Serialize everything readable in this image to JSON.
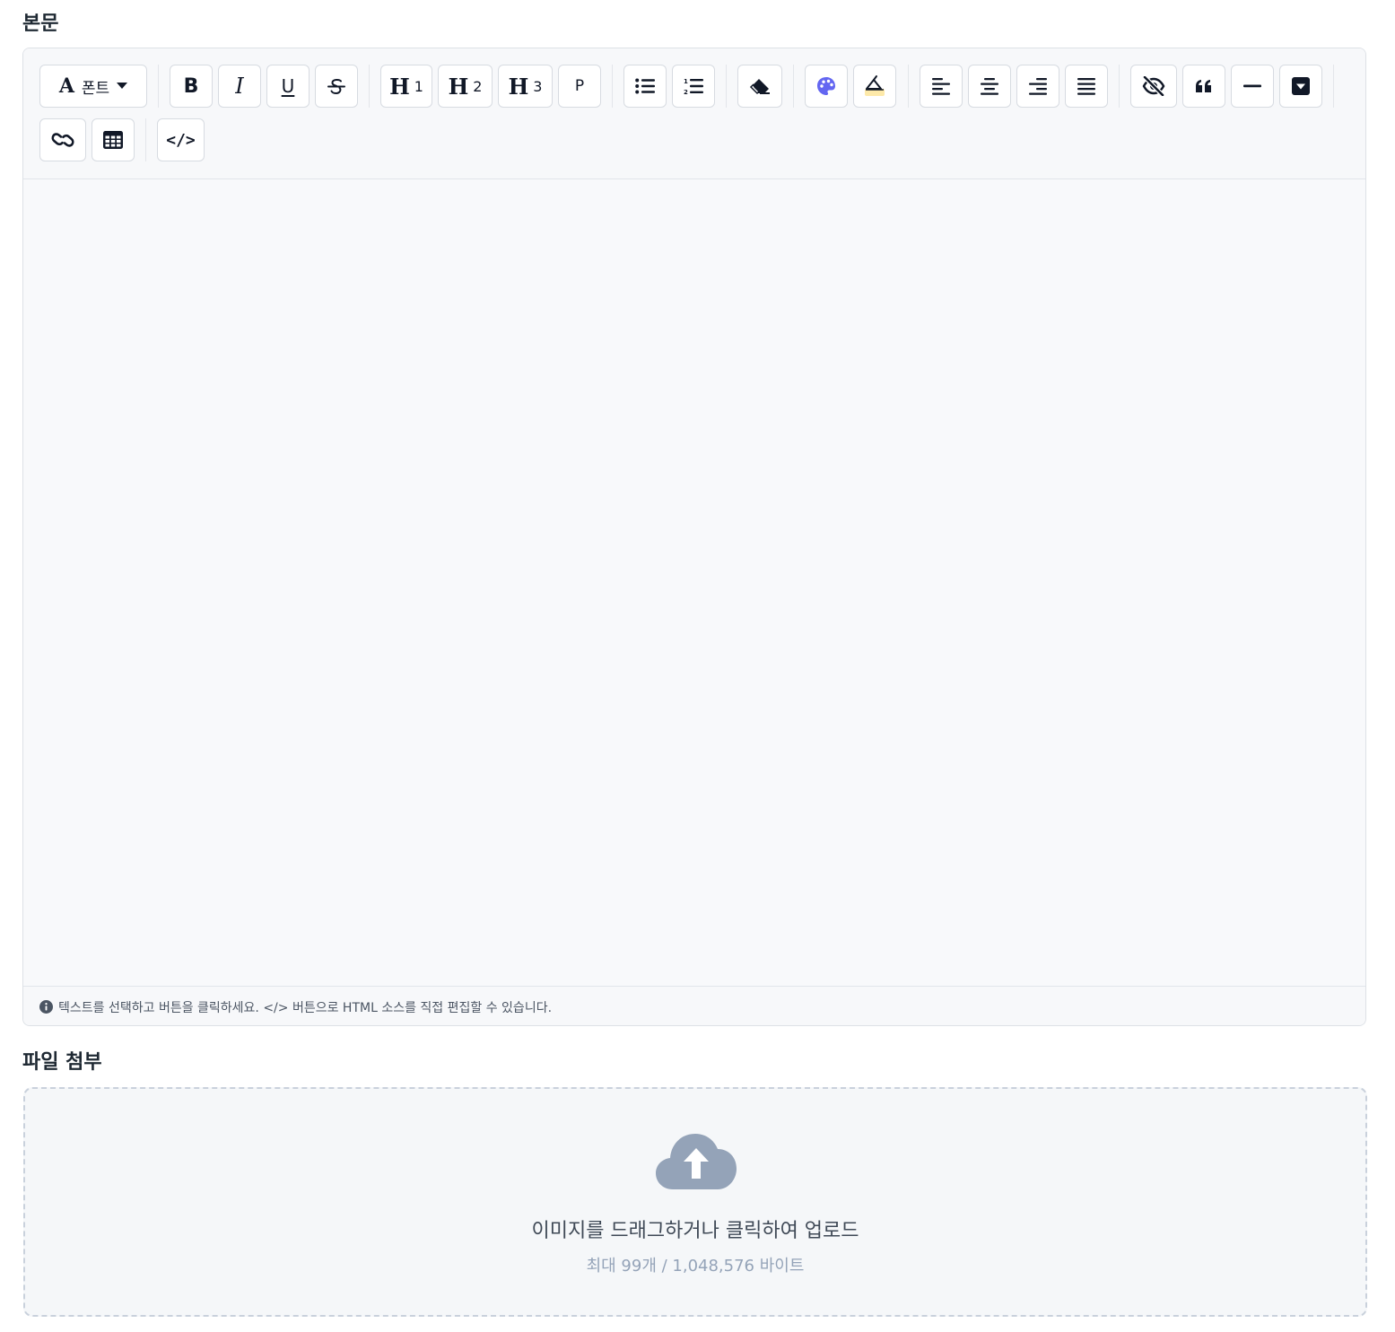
{
  "sections": {
    "body_title": "본문",
    "attach_title": "파일 첨부"
  },
  "toolbar": {
    "font_label": "폰트",
    "font_glyph": "A",
    "bold": "B",
    "italic": "I",
    "underline": "U",
    "h1_glyph": "H",
    "h1_num": "1",
    "h2_glyph": "H",
    "h2_num": "2",
    "h3_glyph": "H",
    "h3_num": "3",
    "paragraph": "P",
    "code_glyph": "</>"
  },
  "icons": {
    "font": "font-icon",
    "caret": "caret-down-icon",
    "strike": "strikethrough-icon",
    "bullet_list": "list-ul-icon",
    "ordered_list": "list-ol-icon",
    "eraser": "eraser-icon",
    "palette": "palette-icon",
    "highlight": "highlighter-icon",
    "align_left": "align-left-icon",
    "align_center": "align-center-icon",
    "align_right": "align-right-icon",
    "align_justify": "align-justify-icon",
    "spoiler": "eye-slash-icon",
    "quote": "quote-left-icon",
    "hr": "minus-icon",
    "fold": "square-caret-down-icon",
    "link": "link-icon",
    "table": "table-icon",
    "code": "code-icon",
    "info": "info-circle-icon",
    "upload": "cloud-upload-icon"
  },
  "colors": {
    "palette_accent": "#6366f1",
    "highlight_accent": "#fde9a9",
    "upload_icon": "#94a3b8"
  },
  "editor": {
    "hint": "텍스트를 선택하고 버튼을 클릭하세요. </> 버튼으로 HTML 소스를 직접 편집할 수 있습니다."
  },
  "upload": {
    "main": "이미지를 드래그하거나 클릭하여 업로드",
    "sub": "최대 99개 / 1,048,576 바이트"
  }
}
